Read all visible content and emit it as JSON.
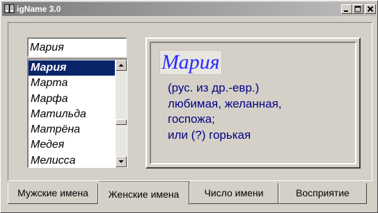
{
  "window": {
    "title": "igName 3.0",
    "controls": {
      "minimize_icon": "minimize-icon",
      "maximize_icon": "maximize-icon",
      "close_icon": "close-icon"
    }
  },
  "search": {
    "value": "Мария"
  },
  "names_list": {
    "items": [
      "Мария",
      "Марта",
      "Марфа",
      "Матильда",
      "Матрёна",
      "Медея",
      "Мелисса"
    ],
    "selected_index": 0
  },
  "description": {
    "title": "Мария",
    "lines": [
      "(рус. из др.-евр.)",
      "любимая, желанная,",
      "госпожа;",
      "или (?) горькая"
    ]
  },
  "tabs": [
    {
      "label": "Мужские имена",
      "active": false
    },
    {
      "label": "Женские имена",
      "active": true
    },
    {
      "label": "Число имени",
      "active": false
    },
    {
      "label": "Восприятие",
      "active": false
    }
  ],
  "colors": {
    "selection": "#0a246a",
    "description_text": "#000080",
    "description_title": "#2a2aff",
    "face": "#d4d0c8"
  }
}
